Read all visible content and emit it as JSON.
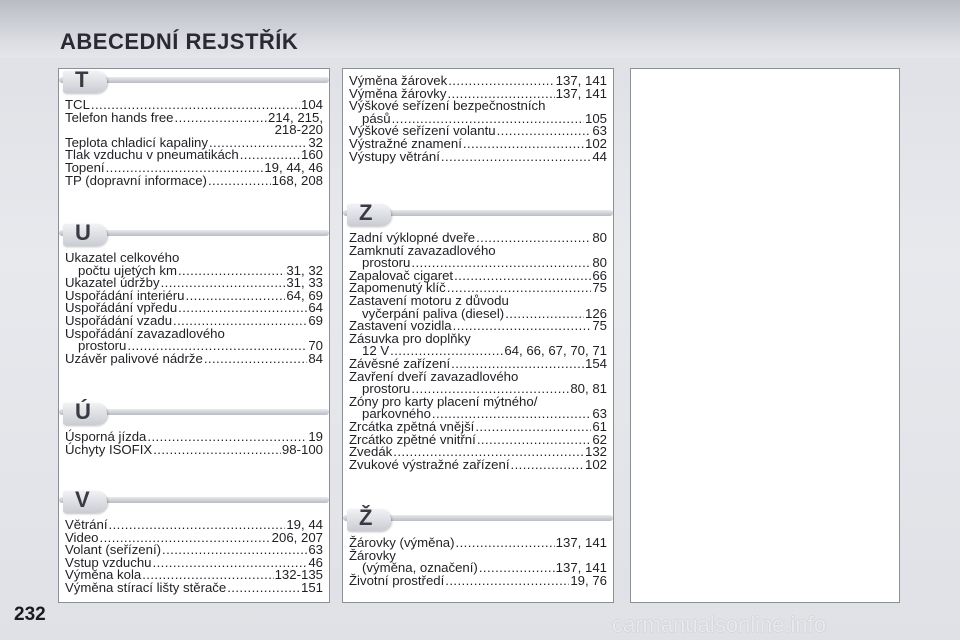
{
  "header": {
    "title": "ABECEDNÍ REJSTŘÍK"
  },
  "footer": {
    "page_number": "232",
    "watermark": "carmanualsonline.info"
  },
  "sections": {
    "T": {
      "letter": "T",
      "entries": [
        {
          "text": "TCL",
          "pages": "104"
        },
        {
          "text": "Telefon hands free",
          "pages": "214, 215,"
        },
        {
          "cont": "218-220"
        },
        {
          "text": "Teplota chladicí kapaliny",
          "pages": "32"
        },
        {
          "text": "Tlak vzduchu v pneumatikách",
          "pages": "160"
        },
        {
          "text": "Topení",
          "pages": "19, 44, 46"
        },
        {
          "text": "TP (dopravní informace)",
          "pages": "168, 208"
        }
      ]
    },
    "U": {
      "letter": "U",
      "entries": [
        {
          "head": "Ukazatel celkového"
        },
        {
          "text": "počtu ujetých km",
          "pages": "31, 32",
          "indent": true
        },
        {
          "text": "Ukazatel údržby",
          "pages": "31, 33"
        },
        {
          "text": "Uspořádání interiéru",
          "pages": "64, 69"
        },
        {
          "text": "Uspořádání vpředu",
          "pages": "64"
        },
        {
          "text": "Uspořádání vzadu",
          "pages": "69"
        },
        {
          "head": "Uspořádání zavazadlového"
        },
        {
          "text": "prostoru",
          "pages": "70",
          "indent": true
        },
        {
          "text": "Uzávěr palivové nádrže",
          "pages": "84"
        }
      ]
    },
    "U_acute": {
      "letter": "Ú",
      "entries": [
        {
          "text": "Úsporná jízda",
          "pages": "19"
        },
        {
          "text": "Úchyty ISOFIX",
          "pages": "98-100"
        }
      ]
    },
    "V": {
      "letter": "V",
      "entries": [
        {
          "text": "Větrání",
          "pages": "19, 44"
        },
        {
          "text": "Video",
          "pages": "206, 207"
        },
        {
          "text": "Volant (seřízení)",
          "pages": "63"
        },
        {
          "text": "Vstup vzduchu",
          "pages": "46"
        },
        {
          "text": "Výměna kola",
          "pages": "132-135"
        },
        {
          "text": "Výměna stírací lišty stěrače",
          "pages": "151"
        }
      ]
    },
    "V_cont": {
      "entries": [
        {
          "text": "Výměna žárovek",
          "pages": "137, 141"
        },
        {
          "text": "Výměna žárovky",
          "pages": "137, 141"
        },
        {
          "head": "Výškové seřízení bezpečnostních"
        },
        {
          "text": "pásů",
          "pages": "105",
          "indent": true
        },
        {
          "text": "Výškové seřízení volantu",
          "pages": "63"
        },
        {
          "text": "Výstražné znamení",
          "pages": "102"
        },
        {
          "text": "Výstupy větrání",
          "pages": "44"
        }
      ]
    },
    "Z": {
      "letter": "Z",
      "entries": [
        {
          "text": "Zadní výklopné dveře",
          "pages": "80"
        },
        {
          "head": "Zamknutí zavazadlového"
        },
        {
          "text": "prostoru",
          "pages": "80",
          "indent": true
        },
        {
          "text": "Zapalovač cigaret",
          "pages": "66"
        },
        {
          "text": "Zapomenutý klíč",
          "pages": "75"
        },
        {
          "head": "Zastavení motoru z důvodu"
        },
        {
          "text": "vyčerpání paliva (diesel)",
          "pages": "126",
          "indent": true
        },
        {
          "text": "Zastavení vozidla",
          "pages": "75"
        },
        {
          "head": "Zásuvka pro doplňky"
        },
        {
          "text": "12 V",
          "pages": "64, 66, 67, 70, 71",
          "indent": true
        },
        {
          "text": "Závěsné zařízení",
          "pages": "154"
        },
        {
          "head": "Zavření dveří zavazadlového"
        },
        {
          "text": "prostoru",
          "pages": "80, 81",
          "indent": true
        },
        {
          "head": "Zóny pro karty placení mýtného/"
        },
        {
          "text": "parkovného",
          "pages": "63",
          "indent": true
        },
        {
          "text": "Zrcátka zpětná vnější",
          "pages": "61"
        },
        {
          "text": "Zrcátko zpětné vnitřní",
          "pages": "62"
        },
        {
          "text": "Zvedák",
          "pages": "132"
        },
        {
          "text": "Zvukové výstražné zařízení",
          "pages": "102"
        }
      ]
    },
    "Z_caron": {
      "letter": "Ž",
      "entries": [
        {
          "text": "Žárovky (výměna)",
          "pages": "137, 141"
        },
        {
          "head": "Žárovky"
        },
        {
          "text": "(výměna, označení)",
          "pages": "137, 141",
          "indent": true
        },
        {
          "text": "Životní prostředí",
          "pages": "19, 76"
        }
      ]
    }
  }
}
